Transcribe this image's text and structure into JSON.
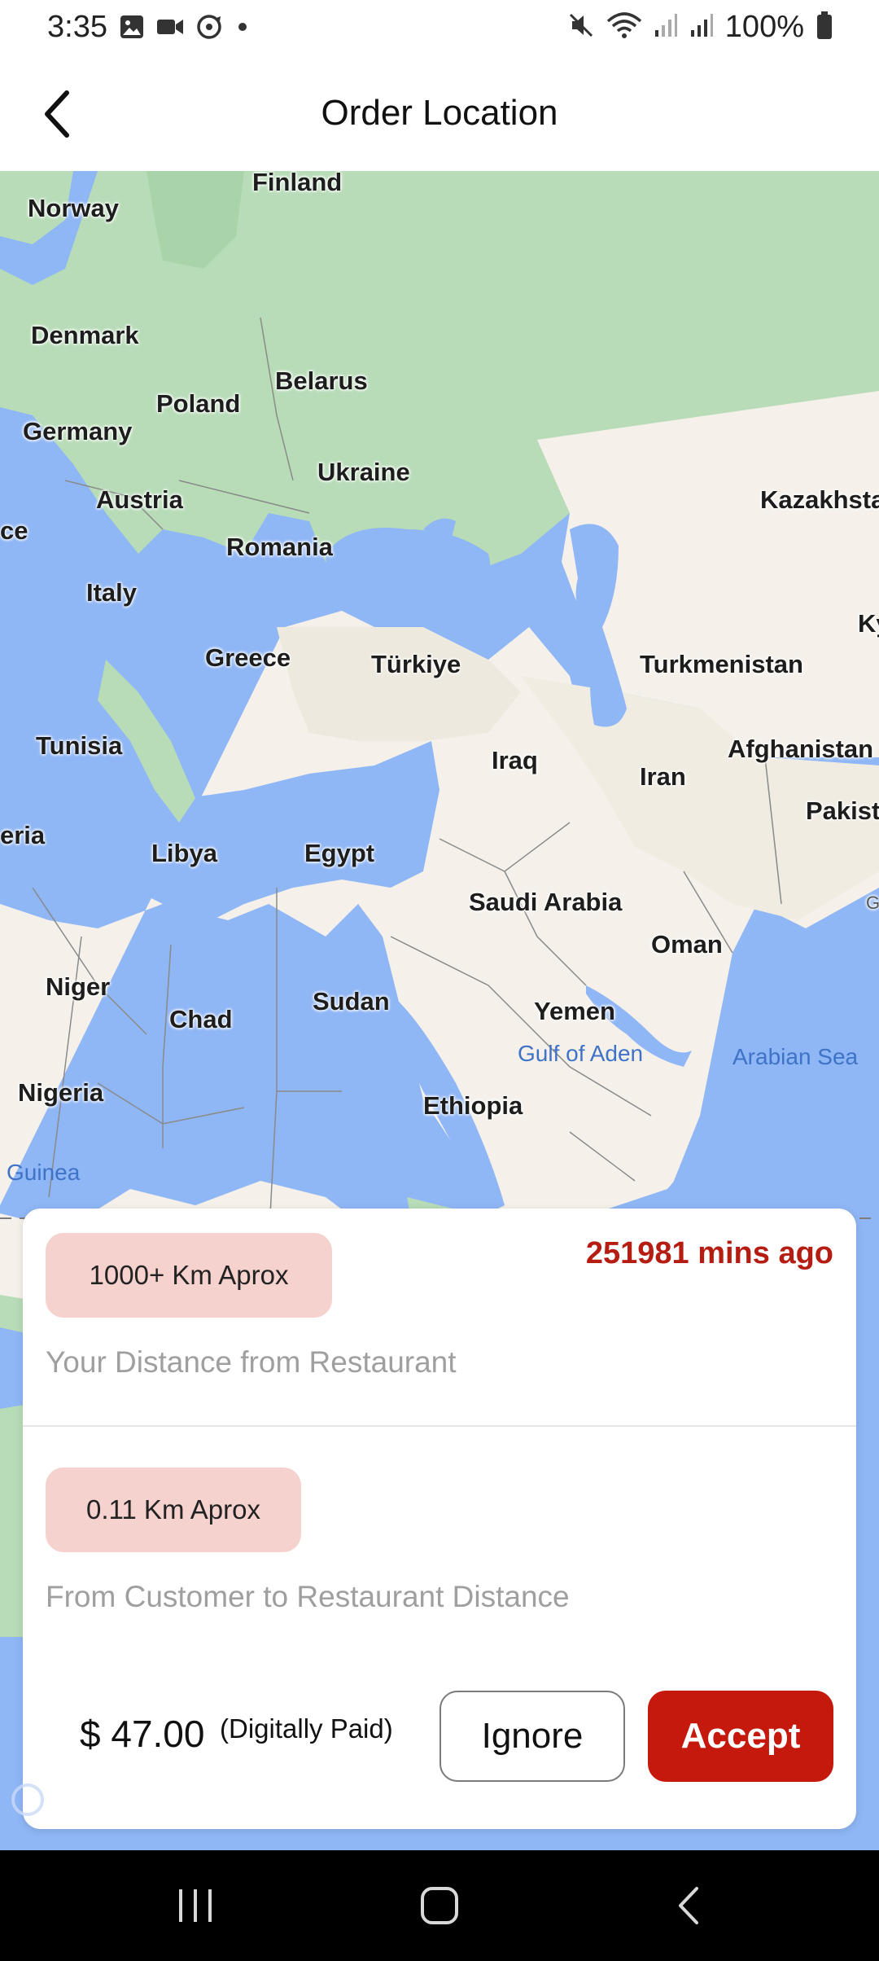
{
  "status_bar": {
    "time": "3:35",
    "battery_text": "100%",
    "left_icons": [
      "image-icon",
      "video-camera-icon",
      "sync-icon",
      "dot-icon"
    ],
    "right_icons": [
      "mute-icon",
      "wifi-icon",
      "signal-icon",
      "signal-icon",
      "battery-icon"
    ]
  },
  "header": {
    "title": "Order Location",
    "back_icon": "chevron-left-icon"
  },
  "map": {
    "labels": {
      "finland": "Finland",
      "norway": "Norway",
      "denmark": "Denmark",
      "belarus": "Belarus",
      "poland": "Poland",
      "germany": "Germany",
      "ukraine": "Ukraine",
      "kazakhstan": "Kazakhsta",
      "austria": "Austria",
      "france": "ce",
      "romania": "Romania",
      "italy": "Italy",
      "kyrgyz": "Ky",
      "greece": "Greece",
      "turkiye": "Türkiye",
      "turkmenistan": "Turkmenistan",
      "tunisia": "Tunisia",
      "iraq": "Iraq",
      "afghanistan": "Afghanistan",
      "iran": "Iran",
      "pakistan": "Pakist",
      "algeria": "eria",
      "libya": "Libya",
      "egypt": "Egypt",
      "saudi": "Saudi Arabia",
      "oman": "Oman",
      "niger": "Niger",
      "chad": "Chad",
      "sudan": "Sudan",
      "yemen": "Yemen",
      "gulf_aden": "Gulf of Aden",
      "arabian_sea": "Arabian Sea",
      "nigeria": "Nigeria",
      "ethiopia": "Ethiopia",
      "guinea": "Guinea",
      "india_g": "G"
    },
    "colors": {
      "water": "#8fb6f5",
      "land": "#f5f1ea",
      "vegetation": "#b8dcb8"
    }
  },
  "order_card": {
    "distance_pill": "1000+ Km Aprox",
    "distance_caption": "Your Distance from Restaurant",
    "time_ago": "251981 mins ago",
    "customer_pill": "0.11 Km Aprox",
    "customer_caption": "From Customer to Restaurant Distance",
    "price": "$ 47.00",
    "payment_note": "(Digitally Paid)",
    "ignore_label": "Ignore",
    "accept_label": "Accept",
    "accent_color": "#c4190c",
    "pill_color": "#f6d2cf"
  },
  "nav_bar": {
    "icons": [
      "recent-apps-icon",
      "home-icon",
      "back-icon"
    ]
  }
}
